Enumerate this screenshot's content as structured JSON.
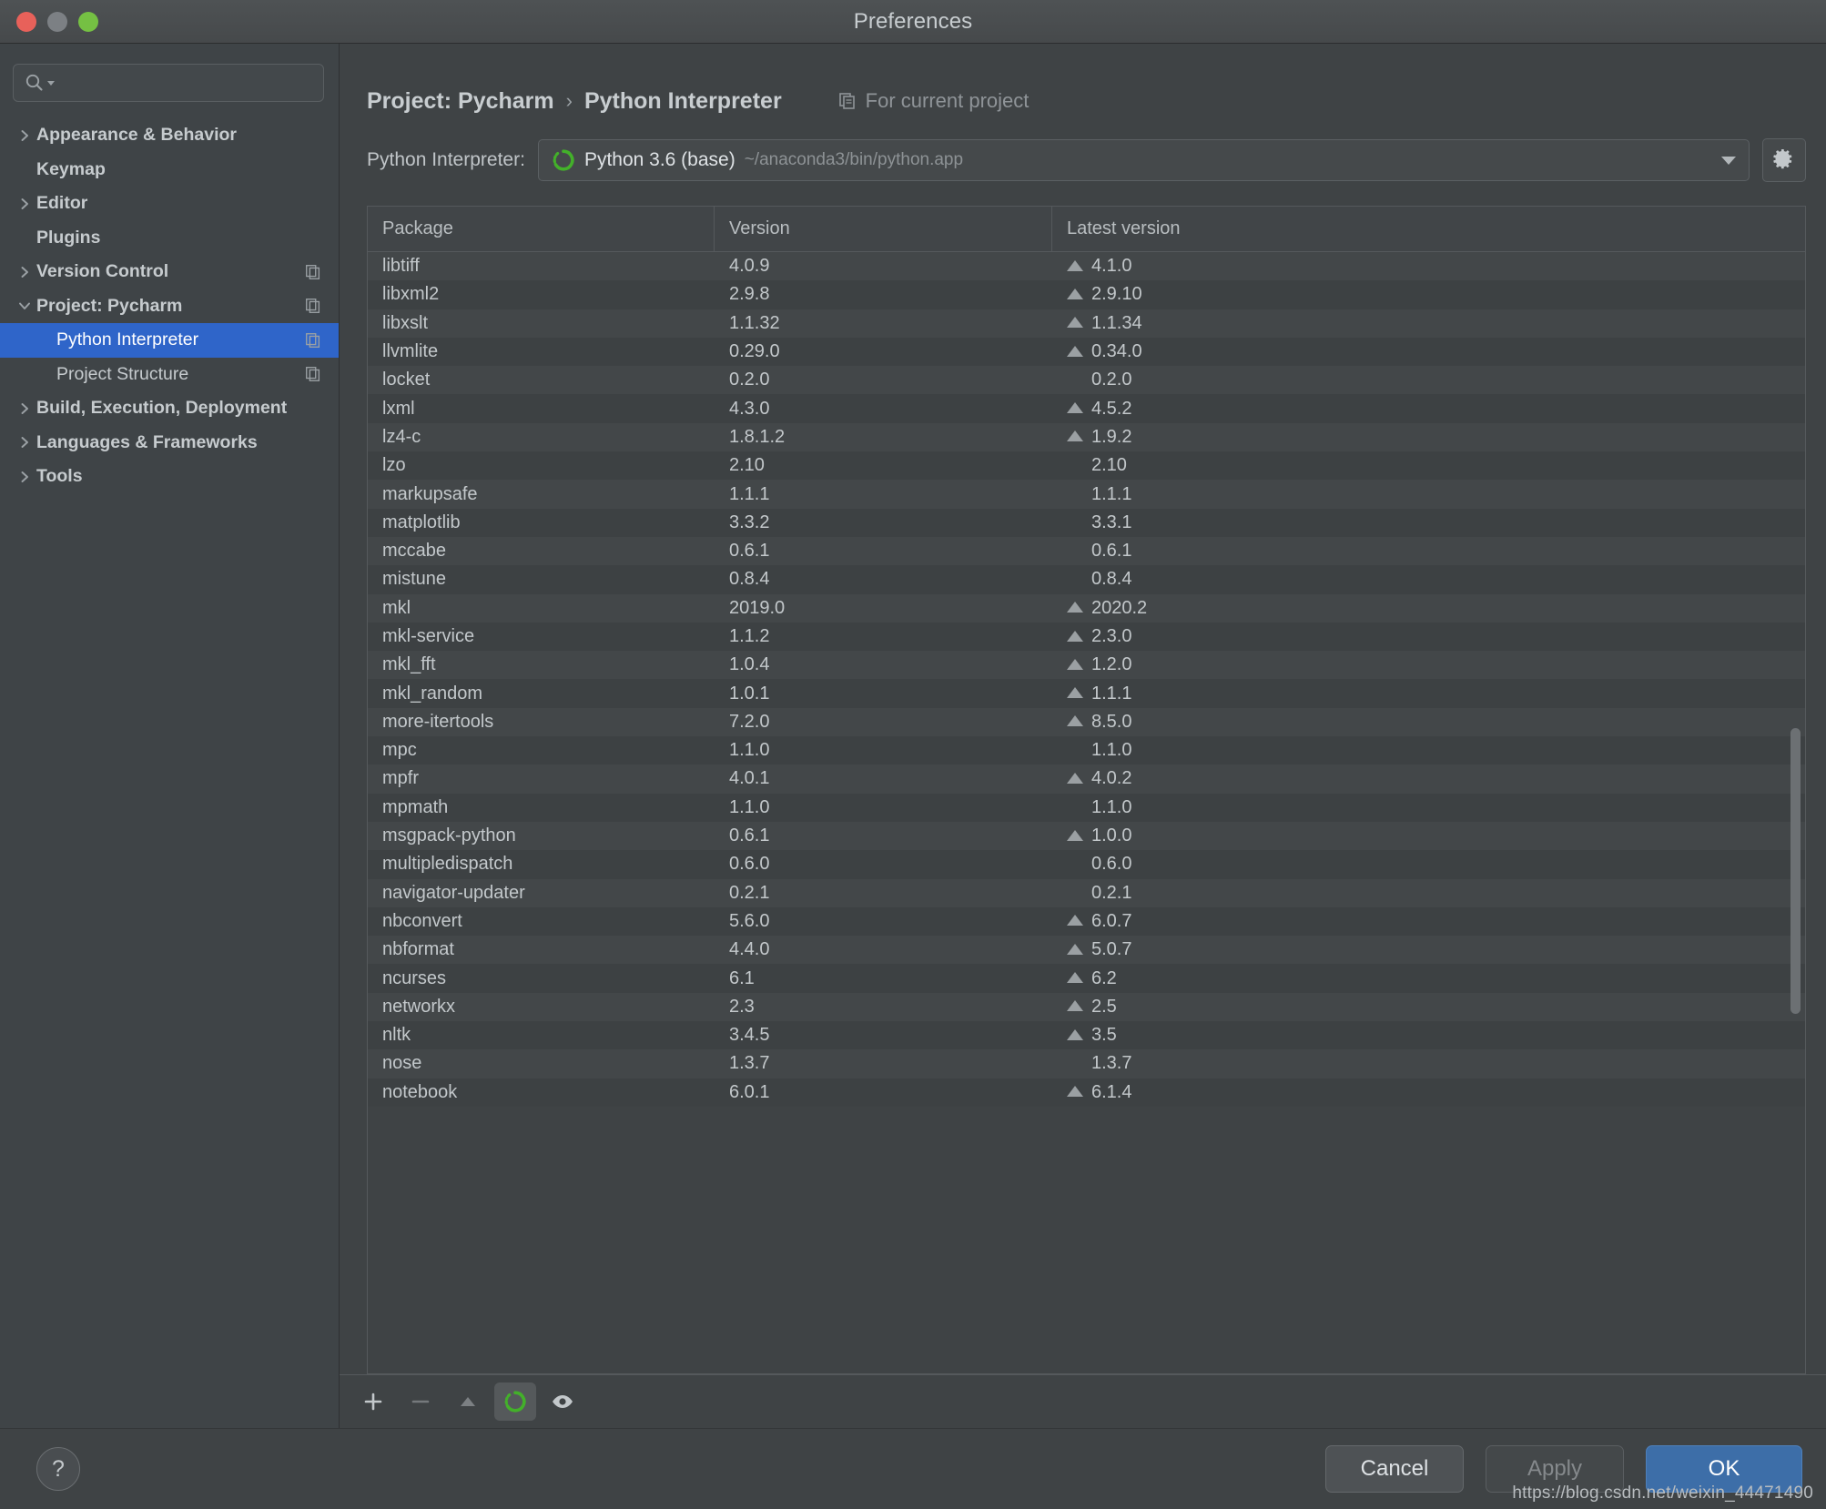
{
  "window": {
    "title": "Preferences",
    "traffic_lights": [
      "close",
      "minimize",
      "zoom"
    ]
  },
  "sidebar": {
    "search": {
      "value": "",
      "placeholder": ""
    },
    "items": [
      {
        "label": "Appearance & Behavior",
        "twisty": "right",
        "level": 0,
        "badge": false,
        "selected": false
      },
      {
        "label": "Keymap",
        "twisty": "none",
        "level": 0,
        "badge": false,
        "selected": false
      },
      {
        "label": "Editor",
        "twisty": "right",
        "level": 0,
        "badge": false,
        "selected": false
      },
      {
        "label": "Plugins",
        "twisty": "none",
        "level": 0,
        "badge": false,
        "selected": false
      },
      {
        "label": "Version Control",
        "twisty": "right",
        "level": 0,
        "badge": true,
        "selected": false
      },
      {
        "label": "Project: Pycharm",
        "twisty": "down",
        "level": 0,
        "badge": true,
        "selected": false
      },
      {
        "label": "Python Interpreter",
        "twisty": "none",
        "level": 1,
        "badge": true,
        "selected": true
      },
      {
        "label": "Project Structure",
        "twisty": "none",
        "level": 1,
        "badge": true,
        "selected": false
      },
      {
        "label": "Build, Execution, Deployment",
        "twisty": "right",
        "level": 0,
        "badge": false,
        "selected": false
      },
      {
        "label": "Languages & Frameworks",
        "twisty": "right",
        "level": 0,
        "badge": false,
        "selected": false
      },
      {
        "label": "Tools",
        "twisty": "right",
        "level": 0,
        "badge": false,
        "selected": false
      }
    ]
  },
  "main": {
    "breadcrumb": {
      "parent": "Project: Pycharm",
      "separator": "›",
      "current": "Python Interpreter",
      "scope_label": "For current project"
    },
    "interpreter": {
      "label": "Python Interpreter:",
      "value": "Python 3.6 (base)",
      "path": "~/anaconda3/bin/python.app",
      "gear_title": "Show All"
    },
    "table": {
      "columns": [
        "Package",
        "Version",
        "Latest version"
      ],
      "rows": [
        {
          "package": "libtiff",
          "version": "4.0.9",
          "latest": "4.1.0",
          "upgrade": true
        },
        {
          "package": "libxml2",
          "version": "2.9.8",
          "latest": "2.9.10",
          "upgrade": true
        },
        {
          "package": "libxslt",
          "version": "1.1.32",
          "latest": "1.1.34",
          "upgrade": true
        },
        {
          "package": "llvmlite",
          "version": "0.29.0",
          "latest": "0.34.0",
          "upgrade": true
        },
        {
          "package": "locket",
          "version": "0.2.0",
          "latest": "0.2.0",
          "upgrade": false
        },
        {
          "package": "lxml",
          "version": "4.3.0",
          "latest": "4.5.2",
          "upgrade": true
        },
        {
          "package": "lz4-c",
          "version": "1.8.1.2",
          "latest": "1.9.2",
          "upgrade": true
        },
        {
          "package": "lzo",
          "version": "2.10",
          "latest": "2.10",
          "upgrade": false
        },
        {
          "package": "markupsafe",
          "version": "1.1.1",
          "latest": "1.1.1",
          "upgrade": false
        },
        {
          "package": "matplotlib",
          "version": "3.3.2",
          "latest": "3.3.1",
          "upgrade": false
        },
        {
          "package": "mccabe",
          "version": "0.6.1",
          "latest": "0.6.1",
          "upgrade": false
        },
        {
          "package": "mistune",
          "version": "0.8.4",
          "latest": "0.8.4",
          "upgrade": false
        },
        {
          "package": "mkl",
          "version": "2019.0",
          "latest": "2020.2",
          "upgrade": true
        },
        {
          "package": "mkl-service",
          "version": "1.1.2",
          "latest": "2.3.0",
          "upgrade": true
        },
        {
          "package": "mkl_fft",
          "version": "1.0.4",
          "latest": "1.2.0",
          "upgrade": true
        },
        {
          "package": "mkl_random",
          "version": "1.0.1",
          "latest": "1.1.1",
          "upgrade": true
        },
        {
          "package": "more-itertools",
          "version": "7.2.0",
          "latest": "8.5.0",
          "upgrade": true
        },
        {
          "package": "mpc",
          "version": "1.1.0",
          "latest": "1.1.0",
          "upgrade": false
        },
        {
          "package": "mpfr",
          "version": "4.0.1",
          "latest": "4.0.2",
          "upgrade": true
        },
        {
          "package": "mpmath",
          "version": "1.1.0",
          "latest": "1.1.0",
          "upgrade": false
        },
        {
          "package": "msgpack-python",
          "version": "0.6.1",
          "latest": "1.0.0",
          "upgrade": true
        },
        {
          "package": "multipledispatch",
          "version": "0.6.0",
          "latest": "0.6.0",
          "upgrade": false
        },
        {
          "package": "navigator-updater",
          "version": "0.2.1",
          "latest": "0.2.1",
          "upgrade": false
        },
        {
          "package": "nbconvert",
          "version": "5.6.0",
          "latest": "6.0.7",
          "upgrade": true
        },
        {
          "package": "nbformat",
          "version": "4.4.0",
          "latest": "5.0.7",
          "upgrade": true
        },
        {
          "package": "ncurses",
          "version": "6.1",
          "latest": "6.2",
          "upgrade": true
        },
        {
          "package": "networkx",
          "version": "2.3",
          "latest": "2.5",
          "upgrade": true
        },
        {
          "package": "nltk",
          "version": "3.4.5",
          "latest": "3.5",
          "upgrade": true
        },
        {
          "package": "nose",
          "version": "1.3.7",
          "latest": "1.3.7",
          "upgrade": false
        },
        {
          "package": "notebook",
          "version": "6.0.1",
          "latest": "6.1.4",
          "upgrade": true
        }
      ]
    },
    "table_toolbar": [
      {
        "name": "add-package-button",
        "icon": "plus-icon",
        "active": false
      },
      {
        "name": "remove-package-button",
        "icon": "minus-icon",
        "active": false
      },
      {
        "name": "upgrade-package-button",
        "icon": "up-arrow-icon",
        "active": false
      },
      {
        "name": "conda-status-button",
        "icon": "conda-ring-icon",
        "active": true
      },
      {
        "name": "show-early-releases-button",
        "icon": "eye-icon",
        "active": false
      }
    ]
  },
  "footer": {
    "help_label": "?",
    "cancel_label": "Cancel",
    "apply_label": "Apply",
    "ok_label": "OK",
    "watermark": "https://blog.csdn.net/weixin_44471490"
  },
  "colors": {
    "accent_blue": "#2f65c9",
    "ok_button": "#3d6ea8",
    "conda_green": "#43b02a",
    "window_bg": "#3f4345",
    "sidebar_bg": "#3f4447"
  }
}
